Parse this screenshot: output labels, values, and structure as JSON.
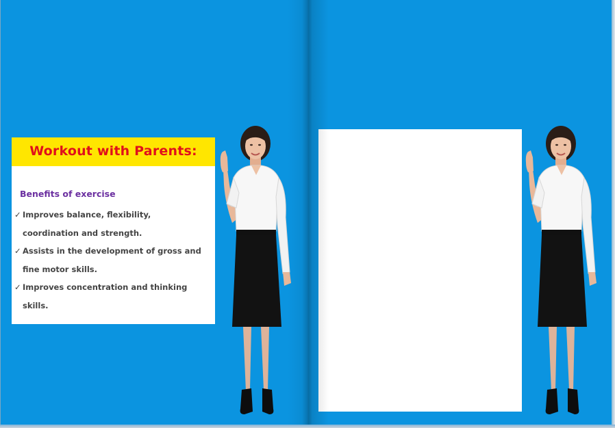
{
  "workout": {
    "title": "Workout with Parents:",
    "subtitle": "Benefits of exercise",
    "check_glyph": "✓",
    "bullets": [
      {
        "line1": "Improves balance, flexibility,",
        "line2": "coordination and strength."
      },
      {
        "line1": "Assists in the development of gross and",
        "line2": "fine motor skills."
      },
      {
        "line1": "Improves concentration and thinking skills.",
        "line2": ""
      }
    ]
  },
  "colors": {
    "page_background": "#0b94e0",
    "header_band": "#ffe600",
    "title_text": "#e0101b",
    "subtitle_text": "#6b2fa0",
    "body_text": "#444444",
    "card": "#ffffff"
  },
  "figures": [
    "woman-pointing-up",
    "woman-pointing-up"
  ]
}
